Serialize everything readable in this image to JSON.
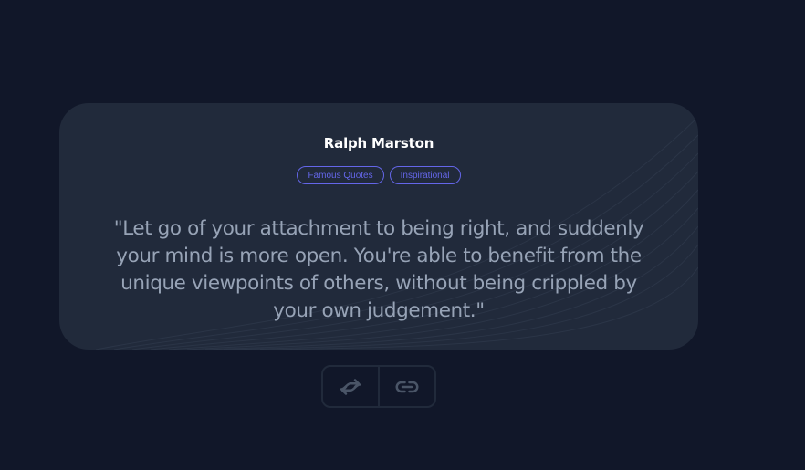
{
  "quote": {
    "author": "Ralph Marston",
    "tags": [
      "Famous Quotes",
      "Inspirational"
    ],
    "text": "\"Let go of your attachment to being right, and suddenly your mind is more open. You're able to benefit from the unique viewpoints of others, without being crippled by your own judgement.\""
  },
  "actions": {
    "shuffle_icon": "random-swap-icon",
    "link_icon": "link-icon"
  },
  "colors": {
    "background": "#111729",
    "card": "#212a3b",
    "accent": "#6466e9",
    "quote_text": "#97a3b6",
    "author_text": "#ffffff"
  }
}
